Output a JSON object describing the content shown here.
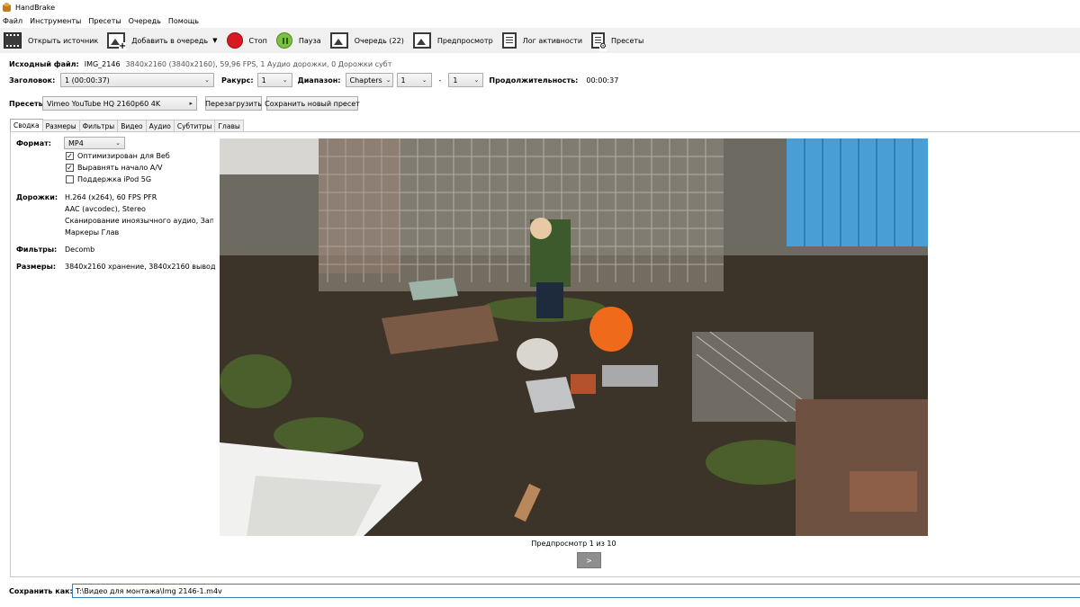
{
  "window": {
    "title": "HandBrake"
  },
  "menu": [
    "Файл",
    "Инструменты",
    "Пресеты",
    "Очередь",
    "Помощь"
  ],
  "toolbar": {
    "open_source": "Открыть источник",
    "add_queue": "Добавить в очередь",
    "stop": "Стоп",
    "pause": "Пауза",
    "queue": "Очередь (22)",
    "preview": "Предпросмотр",
    "activity_log": "Лог активности",
    "presets": "Пресеты"
  },
  "source": {
    "label": "Исходный файл:",
    "name": "IMG_2146",
    "info": "3840x2160 (3840x2160), 59,96 FPS, 1 Аудио дорожки, 0 Дорожки субт"
  },
  "title_row": {
    "title_label": "Заголовок:",
    "title_value": "1 (00:00:37)",
    "angle_label": "Ракурс:",
    "angle_value": "1",
    "range_label": "Диапазон:",
    "range_type": "Chapters",
    "range_from": "1",
    "range_sep": "-",
    "range_to": "1",
    "duration_label": "Продолжительность:",
    "duration_value": "00:00:37"
  },
  "presets_row": {
    "label": "Пресеты",
    "selected": "Vimeo YouTube HQ 2160p60 4K",
    "reload": "Перезагрузить",
    "save_new": "Сохранить новый пресет"
  },
  "tabs": [
    "Сводка",
    "Размеры",
    "Фильтры",
    "Видео",
    "Аудио",
    "Субтитры",
    "Главы"
  ],
  "summary": {
    "format_label": "Формат:",
    "format_value": "MP4",
    "checks": [
      {
        "label": "Оптимизирован для Веб",
        "checked": true
      },
      {
        "label": "Выравнять начало A/V",
        "checked": true
      },
      {
        "label": "Поддержка iPod 5G",
        "checked": false
      }
    ],
    "tracks_label": "Дорожки:",
    "tracks": [
      "H.264 (x264), 60 FPS PFR",
      "AAC (avcodec), Stereo",
      "Сканирование иноязычного аудио, Записано",
      "Маркеры Глав"
    ],
    "filters_label": "Фильтры:",
    "filters_value": "Decomb",
    "sizes_label": "Размеры:",
    "sizes_value": "3840x2160 хранение, 3840x2160 вывод"
  },
  "preview": {
    "caption": "Предпросмотр 1 из 10",
    "next": ">"
  },
  "save": {
    "label": "Сохранить как:",
    "path": "T:\\Видео для монтажа\\Img 2146-1.m4v"
  },
  "colors": {
    "toolbar_bg": "#f0f0f0",
    "stop": "#d71920",
    "pause": "#7cc242",
    "save_border": "#3c7fb1"
  }
}
